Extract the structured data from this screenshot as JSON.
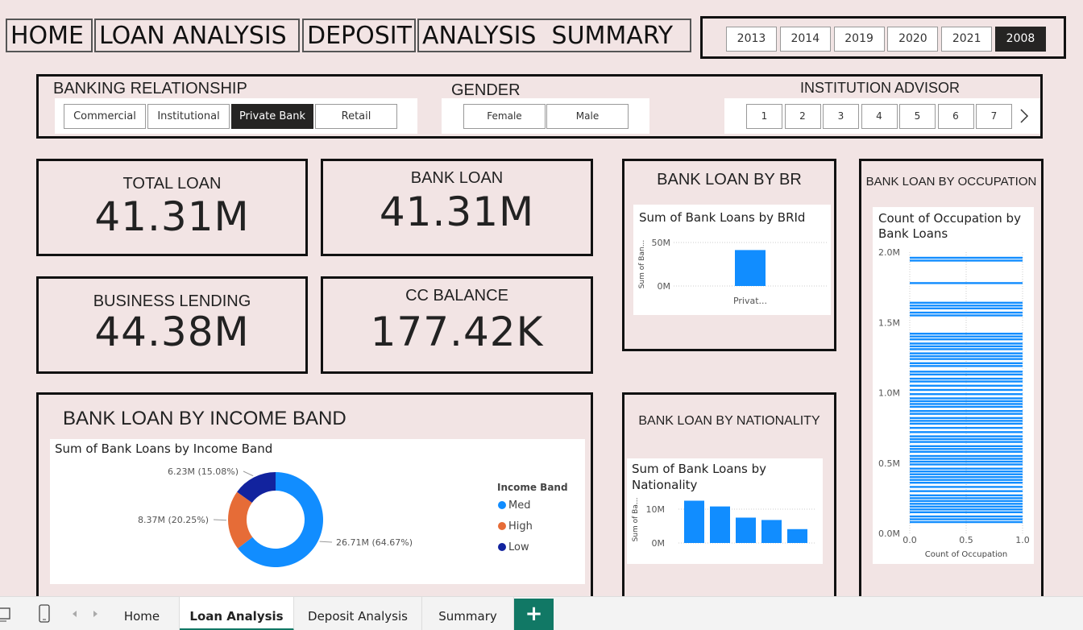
{
  "nav": {
    "home": "HOME",
    "loan_analysis": "LOAN ANALYSIS",
    "deposit": "DEPOSIT",
    "analysis_summary": "ANALYSIS  SUMMARY"
  },
  "years": [
    "2013",
    "2014",
    "2019",
    "2020",
    "2021",
    "2008"
  ],
  "selected_year": "2008",
  "filters": {
    "banking_relationship": {
      "title": "BANKING RELATIONSHIP",
      "options": [
        "Commercial",
        "Institutional",
        "Private Bank",
        "Retail"
      ],
      "selected": "Private Bank"
    },
    "gender": {
      "title": "GENDER",
      "options": [
        "Female",
        "Male"
      ]
    },
    "institution_advisor": {
      "title": "INSTITUTION ADVISOR",
      "options": [
        "1",
        "2",
        "3",
        "4",
        "5",
        "6",
        "7"
      ]
    }
  },
  "kpis": {
    "total_loan": {
      "title": "TOTAL LOAN",
      "value": "41.31M"
    },
    "bank_loan": {
      "title": "BANK LOAN",
      "value": "41.31M"
    },
    "business_lending": {
      "title": "BUSINESS LENDING",
      "value": "44.38M"
    },
    "cc_balance": {
      "title": "CC BALANCE",
      "value": "177.42K"
    }
  },
  "sections": {
    "by_br": "BANK LOAN BY BR",
    "by_occupation": "BANK LOAN BY OCCUPATION",
    "by_income": "BANK LOAN BY INCOME BAND",
    "by_nationality": "BANK LOAN BY NATIONALITY"
  },
  "visual_titles": {
    "br": "Sum of Bank Loans by BRId",
    "occupation": "Count of Occupation by Bank Loans",
    "income": "Sum of Bank Loans by Income Band",
    "nationality": "Sum of Bank Loans by Nationality"
  },
  "colors": {
    "med": "#118DFF",
    "high": "#E66C37",
    "low": "#12239E",
    "bar": "#118DFF"
  },
  "chart_data": [
    {
      "id": "br",
      "type": "bar",
      "categories": [
        "Privat..."
      ],
      "values": [
        41.31
      ],
      "ylabel": "Sum of Ban...",
      "yticks": [
        "0M",
        "50M"
      ],
      "ylim": [
        0,
        50
      ]
    },
    {
      "id": "income",
      "type": "pie",
      "legend_title": "Income Band",
      "legend_position": "right",
      "slices": [
        {
          "name": "Med",
          "value": 26.71,
          "label": "26.71M (64.67%)"
        },
        {
          "name": "High",
          "value": 8.37,
          "label": "8.37M (20.25%)"
        },
        {
          "name": "Low",
          "value": 6.23,
          "label": "6.23M (15.08%)"
        }
      ]
    },
    {
      "id": "nationality",
      "type": "bar",
      "categories": [
        "",
        "",
        "",
        "",
        ""
      ],
      "values": [
        12.5,
        10.8,
        7.5,
        6.8,
        4.1
      ],
      "ylabel": "Sum of Ba...",
      "yticks": [
        "0M",
        "10M"
      ],
      "ylim": [
        0,
        15
      ]
    },
    {
      "id": "occupation",
      "type": "bar",
      "orientation": "horizontal",
      "xlabel": "Count of Occupation",
      "xticks": [
        "0.0",
        "0.5",
        "1.0"
      ],
      "yticks": [
        "0.0M",
        "0.5M",
        "1.0M",
        "1.5M",
        "2.0M"
      ],
      "xlim": [
        0,
        1
      ],
      "ylim": [
        0,
        2.0
      ],
      "values_m": [
        1.96,
        1.94,
        1.78,
        1.64,
        1.62,
        1.6,
        1.57,
        1.55,
        1.42,
        1.4,
        1.38,
        1.35,
        1.33,
        1.31,
        1.28,
        1.26,
        1.24,
        1.21,
        1.19,
        1.15,
        1.13,
        1.1,
        1.08,
        1.05,
        1.02,
        0.99,
        0.96,
        0.94,
        0.92,
        0.9,
        0.87,
        0.85,
        0.82,
        0.8,
        0.78,
        0.75,
        0.72,
        0.69,
        0.67,
        0.65,
        0.62,
        0.6,
        0.58,
        0.55,
        0.53,
        0.51,
        0.49,
        0.46,
        0.44,
        0.42,
        0.4,
        0.38,
        0.36,
        0.33,
        0.3,
        0.27,
        0.25,
        0.23,
        0.21,
        0.19,
        0.17,
        0.15,
        0.12,
        0.1,
        0.08
      ]
    }
  ],
  "tabs": [
    "Home",
    "Loan Analysis",
    "Deposit Analysis",
    "Summary"
  ],
  "active_tab": "Loan Analysis",
  "add_tab_label": "+"
}
